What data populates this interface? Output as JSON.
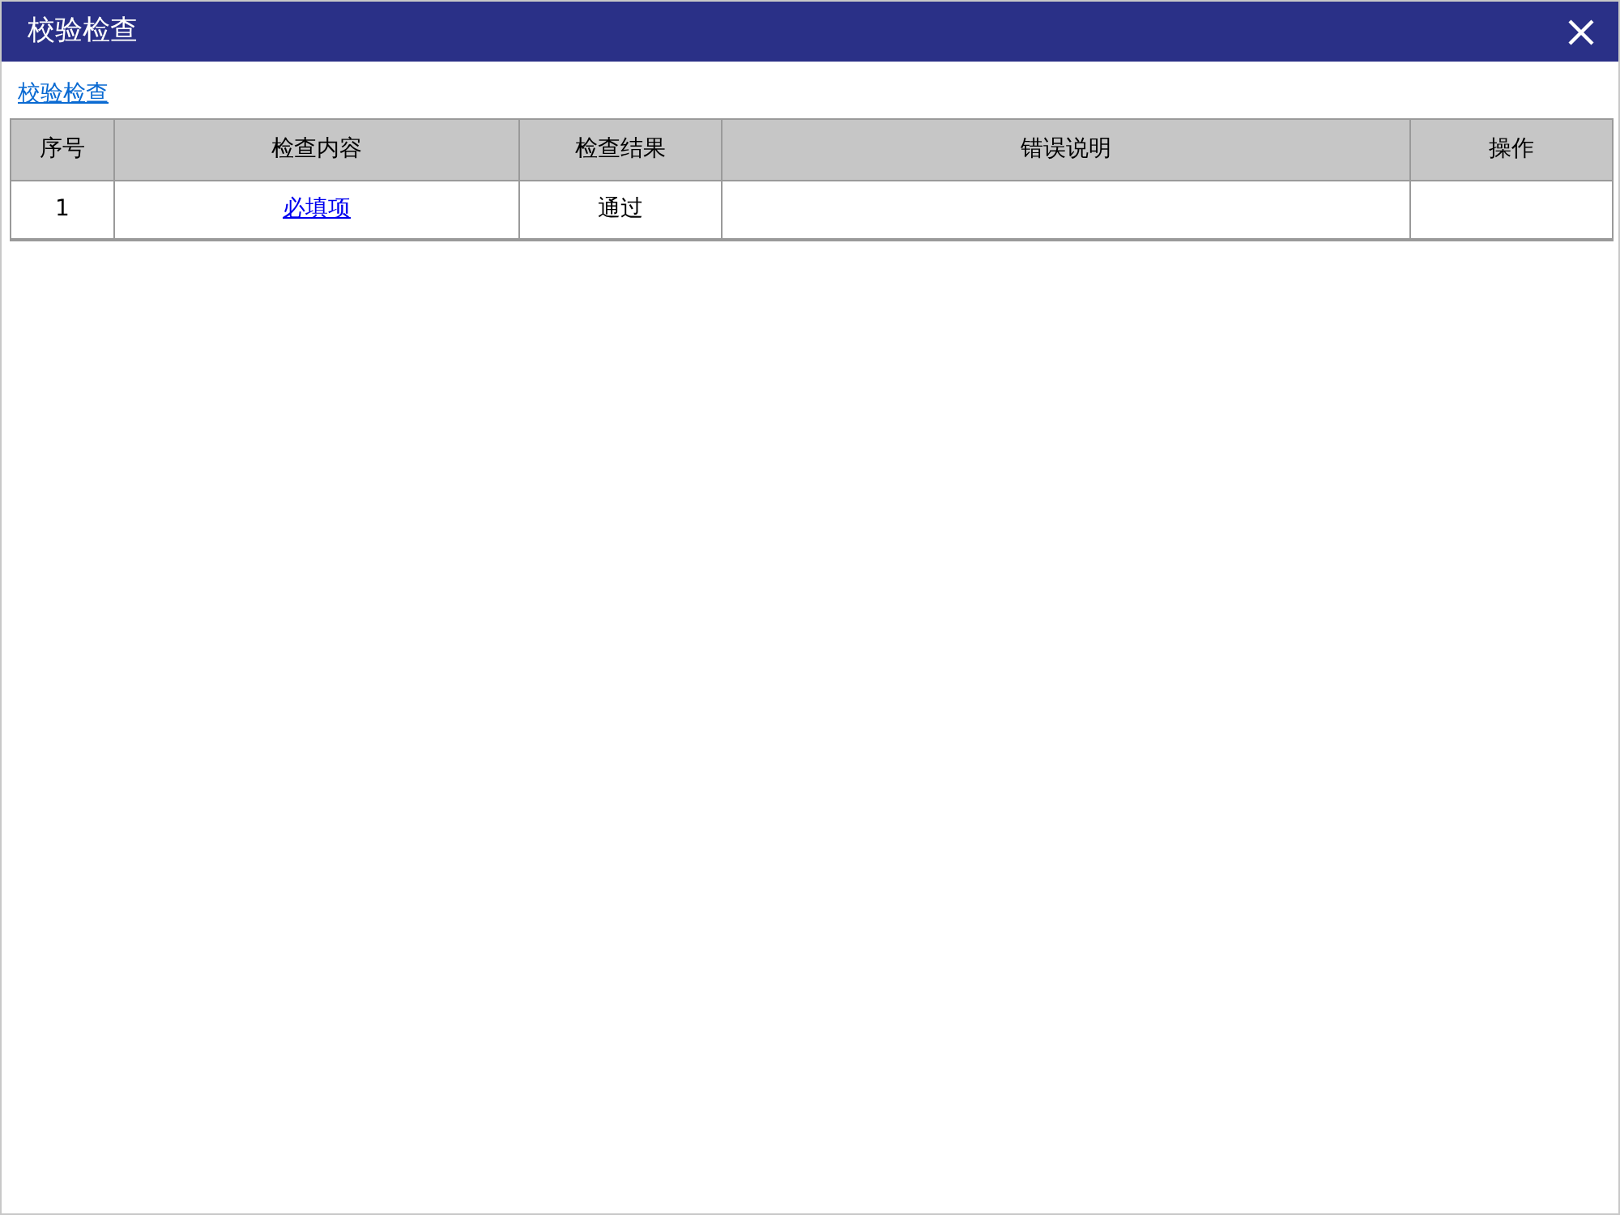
{
  "window": {
    "title": "校验检查"
  },
  "breadcrumb_link": "校验检查",
  "table": {
    "columns": [
      "序号",
      "检查内容",
      "检查结果",
      "错误说明",
      "操作"
    ],
    "rows": [
      {
        "number": "1",
        "check_item": "必填项",
        "result": "通过"
      }
    ]
  }
}
